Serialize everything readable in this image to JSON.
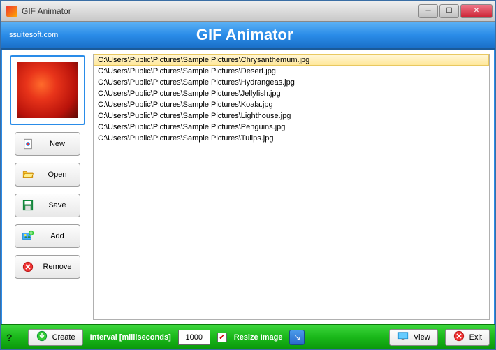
{
  "window": {
    "title": "GIF Animator"
  },
  "header": {
    "brand": "ssuitesoft.com",
    "title": "GIF Animator"
  },
  "sidebar": {
    "buttons": {
      "new": "New",
      "open": "Open",
      "save": "Save",
      "add": "Add",
      "remove": "Remove"
    }
  },
  "files": [
    "C:\\Users\\Public\\Pictures\\Sample Pictures\\Chrysanthemum.jpg",
    "C:\\Users\\Public\\Pictures\\Sample Pictures\\Desert.jpg",
    "C:\\Users\\Public\\Pictures\\Sample Pictures\\Hydrangeas.jpg",
    "C:\\Users\\Public\\Pictures\\Sample Pictures\\Jellyfish.jpg",
    "C:\\Users\\Public\\Pictures\\Sample Pictures\\Koala.jpg",
    "C:\\Users\\Public\\Pictures\\Sample Pictures\\Lighthouse.jpg",
    "C:\\Users\\Public\\Pictures\\Sample Pictures\\Penguins.jpg",
    "C:\\Users\\Public\\Pictures\\Sample Pictures\\Tulips.jpg"
  ],
  "selected_index": 0,
  "footer": {
    "help": "?",
    "create": "Create",
    "interval_label": "Interval [milliseconds]",
    "interval_value": "1000",
    "resize_checked": true,
    "resize_label": "Resize Image",
    "view": "View",
    "exit": "Exit"
  }
}
